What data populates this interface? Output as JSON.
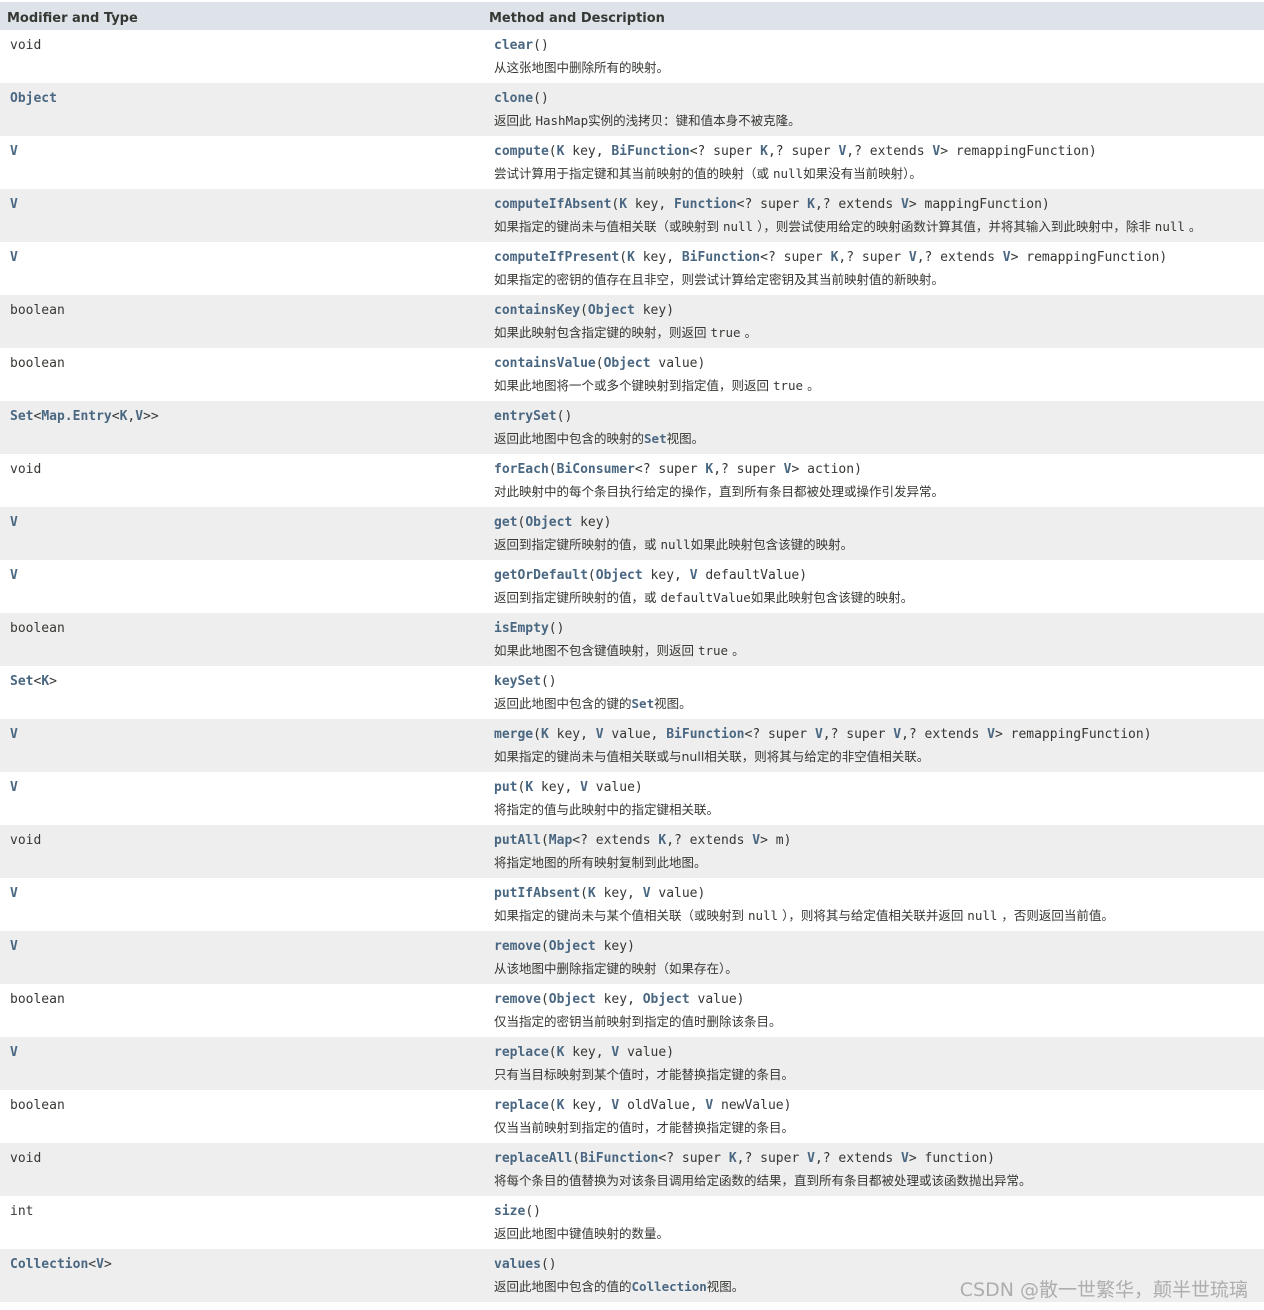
{
  "header": {
    "col1": "Modifier and Type",
    "col2": "Method and Description"
  },
  "colors": {
    "header_bg": "#dee3e9",
    "row_alt_bg": "#eeeeee",
    "link": "#4a6782",
    "text": "#353833"
  },
  "rows": [
    {
      "type": [
        {
          "t": "void",
          "link": false
        }
      ],
      "sig": [
        {
          "t": "clear",
          "link": true
        },
        {
          "t": "()",
          "link": false
        }
      ],
      "desc": [
        {
          "t": "从这张地图中删除所有的映射。"
        }
      ]
    },
    {
      "type": [
        {
          "t": "Object",
          "link": true
        }
      ],
      "sig": [
        {
          "t": "clone",
          "link": true
        },
        {
          "t": "()",
          "link": false
        }
      ],
      "desc": [
        {
          "t": "返回此 "
        },
        {
          "t": "HashMap",
          "code": true
        },
        {
          "t": "实例的浅拷贝：键和值本身不被克隆。"
        }
      ]
    },
    {
      "type": [
        {
          "t": "V",
          "link": true
        }
      ],
      "sig": [
        {
          "t": "compute",
          "link": true
        },
        {
          "t": "(",
          "link": false
        },
        {
          "t": "K",
          "link": true
        },
        {
          "t": " key, ",
          "link": false
        },
        {
          "t": "BiFunction",
          "link": true
        },
        {
          "t": "<? super ",
          "link": false
        },
        {
          "t": "K",
          "link": true
        },
        {
          "t": ",? super ",
          "link": false
        },
        {
          "t": "V",
          "link": true
        },
        {
          "t": ",? extends ",
          "link": false
        },
        {
          "t": "V",
          "link": true
        },
        {
          "t": "> remappingFunction)",
          "link": false
        }
      ],
      "desc": [
        {
          "t": "尝试计算用于指定键和其当前映射的值的映射（或 "
        },
        {
          "t": "null",
          "code": true
        },
        {
          "t": "如果没有当前映射）。"
        }
      ]
    },
    {
      "type": [
        {
          "t": "V",
          "link": true
        }
      ],
      "sig": [
        {
          "t": "computeIfAbsent",
          "link": true
        },
        {
          "t": "(",
          "link": false
        },
        {
          "t": "K",
          "link": true
        },
        {
          "t": " key, ",
          "link": false
        },
        {
          "t": "Function",
          "link": true
        },
        {
          "t": "<? super ",
          "link": false
        },
        {
          "t": "K",
          "link": true
        },
        {
          "t": ",? extends ",
          "link": false
        },
        {
          "t": "V",
          "link": true
        },
        {
          "t": "> mappingFunction)",
          "link": false
        }
      ],
      "desc": [
        {
          "t": "如果指定的键尚未与值相关联（或映射到 "
        },
        {
          "t": "null",
          "code": true
        },
        {
          "t": " ），则尝试使用给定的映射函数计算其值，并将其输入到此映射中，除非 "
        },
        {
          "t": "null",
          "code": true
        },
        {
          "t": " 。"
        }
      ]
    },
    {
      "type": [
        {
          "t": "V",
          "link": true
        }
      ],
      "sig": [
        {
          "t": "computeIfPresent",
          "link": true
        },
        {
          "t": "(",
          "link": false
        },
        {
          "t": "K",
          "link": true
        },
        {
          "t": " key, ",
          "link": false
        },
        {
          "t": "BiFunction",
          "link": true
        },
        {
          "t": "<? super ",
          "link": false
        },
        {
          "t": "K",
          "link": true
        },
        {
          "t": ",? super ",
          "link": false
        },
        {
          "t": "V",
          "link": true
        },
        {
          "t": ",? extends ",
          "link": false
        },
        {
          "t": "V",
          "link": true
        },
        {
          "t": "> remappingFunction)",
          "link": false
        }
      ],
      "desc": [
        {
          "t": "如果指定的密钥的值存在且非空，则尝试计算给定密钥及其当前映射值的新映射。"
        }
      ]
    },
    {
      "type": [
        {
          "t": "boolean",
          "link": false
        }
      ],
      "sig": [
        {
          "t": "containsKey",
          "link": true
        },
        {
          "t": "(",
          "link": false
        },
        {
          "t": "Object",
          "link": true
        },
        {
          "t": " key)",
          "link": false
        }
      ],
      "desc": [
        {
          "t": "如果此映射包含指定键的映射，则返回 "
        },
        {
          "t": "true",
          "code": true
        },
        {
          "t": " 。"
        }
      ]
    },
    {
      "type": [
        {
          "t": "boolean",
          "link": false
        }
      ],
      "sig": [
        {
          "t": "containsValue",
          "link": true
        },
        {
          "t": "(",
          "link": false
        },
        {
          "t": "Object",
          "link": true
        },
        {
          "t": " value)",
          "link": false
        }
      ],
      "desc": [
        {
          "t": "如果此地图将一个或多个键映射到指定值，则返回 "
        },
        {
          "t": "true",
          "code": true
        },
        {
          "t": " 。"
        }
      ]
    },
    {
      "type": [
        {
          "t": "Set",
          "link": true
        },
        {
          "t": "<",
          "link": false
        },
        {
          "t": "Map.Entry",
          "link": true
        },
        {
          "t": "<",
          "link": false
        },
        {
          "t": "K",
          "link": true
        },
        {
          "t": ",",
          "link": false
        },
        {
          "t": "V",
          "link": true
        },
        {
          "t": ">>",
          "link": false
        }
      ],
      "sig": [
        {
          "t": "entrySet",
          "link": true
        },
        {
          "t": "()",
          "link": false
        }
      ],
      "desc": [
        {
          "t": "返回此地图中包含的映射的"
        },
        {
          "t": "Set",
          "code": true,
          "link": true
        },
        {
          "t": "视图。"
        }
      ]
    },
    {
      "type": [
        {
          "t": "void",
          "link": false
        }
      ],
      "sig": [
        {
          "t": "forEach",
          "link": true
        },
        {
          "t": "(",
          "link": false
        },
        {
          "t": "BiConsumer",
          "link": true
        },
        {
          "t": "<? super ",
          "link": false
        },
        {
          "t": "K",
          "link": true
        },
        {
          "t": ",? super ",
          "link": false
        },
        {
          "t": "V",
          "link": true
        },
        {
          "t": "> action)",
          "link": false
        }
      ],
      "desc": [
        {
          "t": "对此映射中的每个条目执行给定的操作，直到所有条目都被处理或操作引发异常。"
        }
      ]
    },
    {
      "type": [
        {
          "t": "V",
          "link": true
        }
      ],
      "sig": [
        {
          "t": "get",
          "link": true
        },
        {
          "t": "(",
          "link": false
        },
        {
          "t": "Object",
          "link": true
        },
        {
          "t": " key)",
          "link": false
        }
      ],
      "desc": [
        {
          "t": "返回到指定键所映射的值，或 "
        },
        {
          "t": "null",
          "code": true
        },
        {
          "t": "如果此映射包含该键的映射。"
        }
      ]
    },
    {
      "type": [
        {
          "t": "V",
          "link": true
        }
      ],
      "sig": [
        {
          "t": "getOrDefault",
          "link": true
        },
        {
          "t": "(",
          "link": false
        },
        {
          "t": "Object",
          "link": true
        },
        {
          "t": " key, ",
          "link": false
        },
        {
          "t": "V",
          "link": true
        },
        {
          "t": " defaultValue)",
          "link": false
        }
      ],
      "desc": [
        {
          "t": "返回到指定键所映射的值，或 "
        },
        {
          "t": "defaultValue",
          "code": true
        },
        {
          "t": "如果此映射包含该键的映射。"
        }
      ]
    },
    {
      "type": [
        {
          "t": "boolean",
          "link": false
        }
      ],
      "sig": [
        {
          "t": "isEmpty",
          "link": true
        },
        {
          "t": "()",
          "link": false
        }
      ],
      "desc": [
        {
          "t": "如果此地图不包含键值映射，则返回 "
        },
        {
          "t": "true",
          "code": true
        },
        {
          "t": " 。"
        }
      ]
    },
    {
      "type": [
        {
          "t": "Set",
          "link": true
        },
        {
          "t": "<",
          "link": false
        },
        {
          "t": "K",
          "link": true
        },
        {
          "t": ">",
          "link": false
        }
      ],
      "sig": [
        {
          "t": "keySet",
          "link": true
        },
        {
          "t": "()",
          "link": false
        }
      ],
      "desc": [
        {
          "t": "返回此地图中包含的键的"
        },
        {
          "t": "Set",
          "code": true,
          "link": true
        },
        {
          "t": "视图。"
        }
      ]
    },
    {
      "type": [
        {
          "t": "V",
          "link": true
        }
      ],
      "sig": [
        {
          "t": "merge",
          "link": true
        },
        {
          "t": "(",
          "link": false
        },
        {
          "t": "K",
          "link": true
        },
        {
          "t": " key, ",
          "link": false
        },
        {
          "t": "V",
          "link": true
        },
        {
          "t": " value, ",
          "link": false
        },
        {
          "t": "BiFunction",
          "link": true
        },
        {
          "t": "<? super ",
          "link": false
        },
        {
          "t": "V",
          "link": true
        },
        {
          "t": ",? super ",
          "link": false
        },
        {
          "t": "V",
          "link": true
        },
        {
          "t": ",? extends ",
          "link": false
        },
        {
          "t": "V",
          "link": true
        },
        {
          "t": "> remappingFunction)",
          "link": false
        }
      ],
      "desc": [
        {
          "t": "如果指定的键尚未与值相关联或与null相关联，则将其与给定的非空值相关联。"
        }
      ]
    },
    {
      "type": [
        {
          "t": "V",
          "link": true
        }
      ],
      "sig": [
        {
          "t": "put",
          "link": true
        },
        {
          "t": "(",
          "link": false
        },
        {
          "t": "K",
          "link": true
        },
        {
          "t": " key, ",
          "link": false
        },
        {
          "t": "V",
          "link": true
        },
        {
          "t": " value)",
          "link": false
        }
      ],
      "desc": [
        {
          "t": "将指定的值与此映射中的指定键相关联。"
        }
      ]
    },
    {
      "type": [
        {
          "t": "void",
          "link": false
        }
      ],
      "sig": [
        {
          "t": "putAll",
          "link": true
        },
        {
          "t": "(",
          "link": false
        },
        {
          "t": "Map",
          "link": true
        },
        {
          "t": "<? extends ",
          "link": false
        },
        {
          "t": "K",
          "link": true
        },
        {
          "t": ",? extends ",
          "link": false
        },
        {
          "t": "V",
          "link": true
        },
        {
          "t": "> m)",
          "link": false
        }
      ],
      "desc": [
        {
          "t": "将指定地图的所有映射复制到此地图。"
        }
      ]
    },
    {
      "type": [
        {
          "t": "V",
          "link": true
        }
      ],
      "sig": [
        {
          "t": "putIfAbsent",
          "link": true
        },
        {
          "t": "(",
          "link": false
        },
        {
          "t": "K",
          "link": true
        },
        {
          "t": " key, ",
          "link": false
        },
        {
          "t": "V",
          "link": true
        },
        {
          "t": " value)",
          "link": false
        }
      ],
      "desc": [
        {
          "t": "如果指定的键尚未与某个值相关联（或映射到 "
        },
        {
          "t": "null",
          "code": true
        },
        {
          "t": " ），则将其与给定值相关联并返回 "
        },
        {
          "t": "null",
          "code": true
        },
        {
          "t": " ，否则返回当前值。"
        }
      ]
    },
    {
      "type": [
        {
          "t": "V",
          "link": true
        }
      ],
      "sig": [
        {
          "t": "remove",
          "link": true
        },
        {
          "t": "(",
          "link": false
        },
        {
          "t": "Object",
          "link": true
        },
        {
          "t": " key)",
          "link": false
        }
      ],
      "desc": [
        {
          "t": "从该地图中删除指定键的映射（如果存在）。"
        }
      ]
    },
    {
      "type": [
        {
          "t": "boolean",
          "link": false
        }
      ],
      "sig": [
        {
          "t": "remove",
          "link": true
        },
        {
          "t": "(",
          "link": false
        },
        {
          "t": "Object",
          "link": true
        },
        {
          "t": " key, ",
          "link": false
        },
        {
          "t": "Object",
          "link": true
        },
        {
          "t": " value)",
          "link": false
        }
      ],
      "desc": [
        {
          "t": "仅当指定的密钥当前映射到指定的值时删除该条目。"
        }
      ]
    },
    {
      "type": [
        {
          "t": "V",
          "link": true
        }
      ],
      "sig": [
        {
          "t": "replace",
          "link": true
        },
        {
          "t": "(",
          "link": false
        },
        {
          "t": "K",
          "link": true
        },
        {
          "t": " key, ",
          "link": false
        },
        {
          "t": "V",
          "link": true
        },
        {
          "t": " value)",
          "link": false
        }
      ],
      "desc": [
        {
          "t": "只有当目标映射到某个值时，才能替换指定键的条目。"
        }
      ]
    },
    {
      "type": [
        {
          "t": "boolean",
          "link": false
        }
      ],
      "sig": [
        {
          "t": "replace",
          "link": true
        },
        {
          "t": "(",
          "link": false
        },
        {
          "t": "K",
          "link": true
        },
        {
          "t": " key, ",
          "link": false
        },
        {
          "t": "V",
          "link": true
        },
        {
          "t": " oldValue, ",
          "link": false
        },
        {
          "t": "V",
          "link": true
        },
        {
          "t": " newValue)",
          "link": false
        }
      ],
      "desc": [
        {
          "t": "仅当当前映射到指定的值时，才能替换指定键的条目。"
        }
      ]
    },
    {
      "type": [
        {
          "t": "void",
          "link": false
        }
      ],
      "sig": [
        {
          "t": "replaceAll",
          "link": true
        },
        {
          "t": "(",
          "link": false
        },
        {
          "t": "BiFunction",
          "link": true
        },
        {
          "t": "<? super ",
          "link": false
        },
        {
          "t": "K",
          "link": true
        },
        {
          "t": ",? super ",
          "link": false
        },
        {
          "t": "V",
          "link": true
        },
        {
          "t": ",? extends ",
          "link": false
        },
        {
          "t": "V",
          "link": true
        },
        {
          "t": "> function)",
          "link": false
        }
      ],
      "desc": [
        {
          "t": "将每个条目的值替换为对该条目调用给定函数的结果，直到所有条目都被处理或该函数抛出异常。"
        }
      ]
    },
    {
      "type": [
        {
          "t": "int",
          "link": false
        }
      ],
      "sig": [
        {
          "t": "size",
          "link": true
        },
        {
          "t": "()",
          "link": false
        }
      ],
      "desc": [
        {
          "t": "返回此地图中键值映射的数量。"
        }
      ]
    },
    {
      "type": [
        {
          "t": "Collection",
          "link": true
        },
        {
          "t": "<",
          "link": false
        },
        {
          "t": "V",
          "link": true
        },
        {
          "t": ">",
          "link": false
        }
      ],
      "sig": [
        {
          "t": "values",
          "link": true
        },
        {
          "t": "()",
          "link": false
        }
      ],
      "desc": [
        {
          "t": "返回此地图中包含的值的"
        },
        {
          "t": "Collection",
          "code": true,
          "link": true
        },
        {
          "t": "视图。"
        }
      ]
    }
  ],
  "watermark": "CSDN @散一世繁华，颠半世琉璃"
}
